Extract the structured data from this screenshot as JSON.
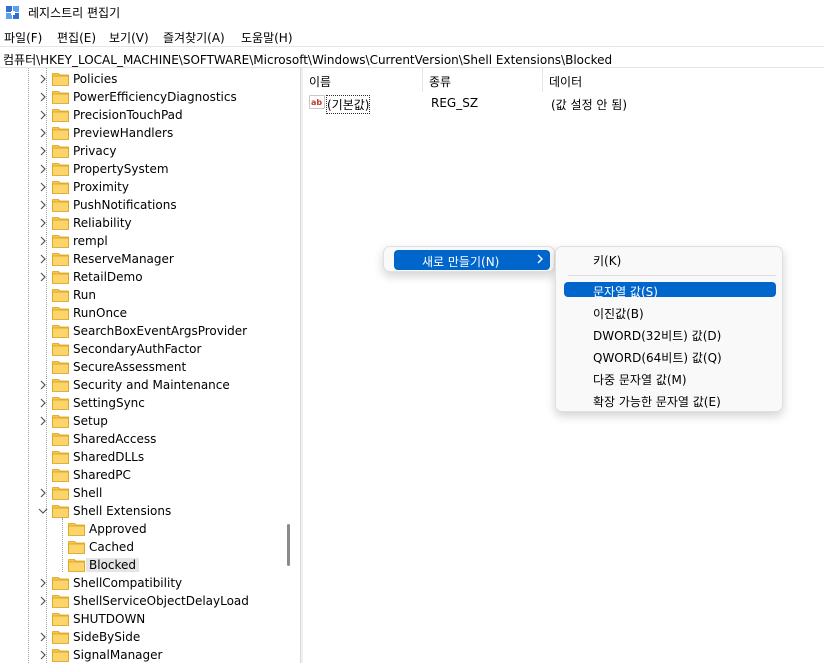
{
  "window": {
    "title": "레지스트리 편집기",
    "icon": "registry-editor-icon"
  },
  "menubar": {
    "file": "파일(F)",
    "edit": "편집(E)",
    "view": "보기(V)",
    "favorites": "즐겨찾기(A)",
    "help": "도움말(H)"
  },
  "address": {
    "path": "컴퓨터\\HKEY_LOCAL_MACHINE\\SOFTWARE\\Microsoft\\Windows\\CurrentVersion\\Shell Extensions\\Blocked"
  },
  "tree": {
    "items": [
      {
        "label": "Policies"
      },
      {
        "label": "PowerEfficiencyDiagnostics"
      },
      {
        "label": "PrecisionTouchPad"
      },
      {
        "label": "PreviewHandlers"
      },
      {
        "label": "Privacy"
      },
      {
        "label": "PropertySystem"
      },
      {
        "label": "Proximity"
      },
      {
        "label": "PushNotifications"
      },
      {
        "label": "Reliability"
      },
      {
        "label": "rempl"
      },
      {
        "label": "ReserveManager"
      },
      {
        "label": "RetailDemo"
      },
      {
        "label": "Run"
      },
      {
        "label": "RunOnce"
      },
      {
        "label": "SearchBoxEventArgsProvider"
      },
      {
        "label": "SecondaryAuthFactor"
      },
      {
        "label": "SecureAssessment"
      },
      {
        "label": "Security and Maintenance"
      },
      {
        "label": "SettingSync"
      },
      {
        "label": "Setup"
      },
      {
        "label": "SharedAccess"
      },
      {
        "label": "SharedDLLs"
      },
      {
        "label": "SharedPC"
      },
      {
        "label": "Shell"
      },
      {
        "label": "Shell Extensions"
      },
      {
        "label": "Approved"
      },
      {
        "label": "Cached"
      },
      {
        "label": "Blocked"
      },
      {
        "label": "ShellCompatibility"
      },
      {
        "label": "ShellServiceObjectDelayLoad"
      },
      {
        "label": "SHUTDOWN"
      },
      {
        "label": "SideBySide"
      },
      {
        "label": "SignalManager"
      }
    ]
  },
  "list": {
    "columns": {
      "name": "이름",
      "type": "종류",
      "data": "데이터"
    },
    "rows": [
      {
        "name": "(기본값)",
        "type": "REG_SZ",
        "data": "(값 설정 안 됨)"
      }
    ]
  },
  "context_menu": {
    "new": "새로 만들기(N)"
  },
  "submenu": {
    "key": "키(K)",
    "string_value": "문자열 값(S)",
    "binary_value": "이진값(B)",
    "dword_value": "DWORD(32비트) 값(D)",
    "qword_value": "QWORD(64비트) 값(Q)",
    "multi_string_value": "다중 문자열 값(M)",
    "expandable_string_value": "확장 가능한 문자열 값(E)"
  },
  "colors": {
    "highlight": "#0066cc",
    "folder": "#f6c64e"
  }
}
